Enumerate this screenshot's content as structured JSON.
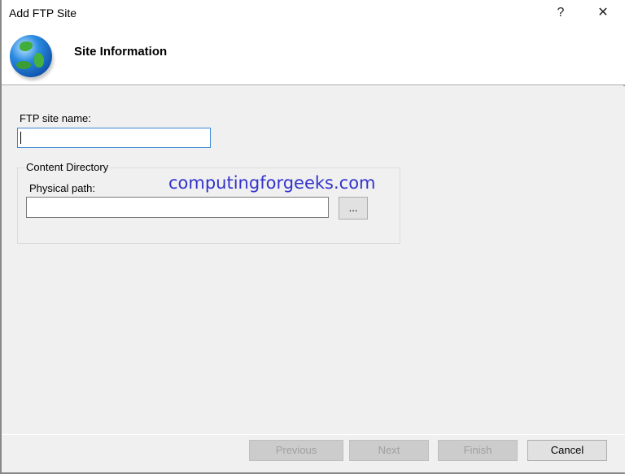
{
  "window": {
    "title": "Add FTP Site",
    "help_label": "?",
    "close_label": "✕"
  },
  "header": {
    "title": "Site Information",
    "icon": "globe-icon"
  },
  "form": {
    "site_name_label": "FTP site name:",
    "site_name_value": "",
    "content_directory_label": "Content Directory",
    "physical_path_label": "Physical path:",
    "physical_path_value": "",
    "browse_label": "..."
  },
  "watermark": "computingforgeeks.com",
  "footer": {
    "previous": "Previous",
    "next": "Next",
    "finish": "Finish",
    "cancel": "Cancel"
  }
}
